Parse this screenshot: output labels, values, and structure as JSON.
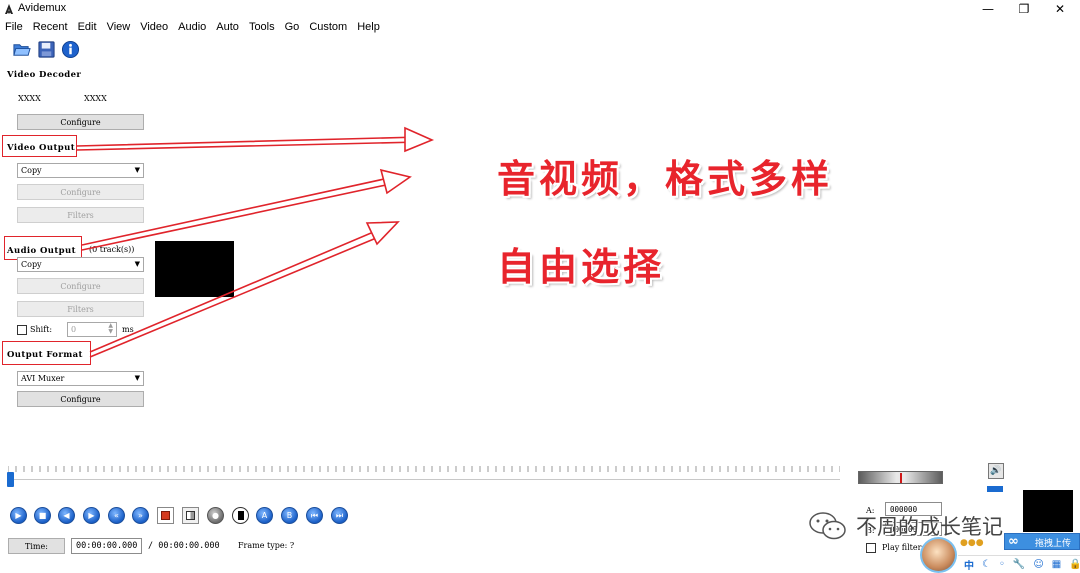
{
  "window": {
    "title": "Avidemux",
    "minimize": "—",
    "maximize": "❐",
    "close": "✕"
  },
  "menu": [
    "File",
    "Recent",
    "Edit",
    "View",
    "Video",
    "Audio",
    "Auto",
    "Tools",
    "Go",
    "Custom",
    "Help"
  ],
  "toolbar": {
    "icons": [
      "open-folder-icon",
      "save-icon",
      "info-icon"
    ]
  },
  "video_decoder": {
    "title": "Video Decoder",
    "codec_left": "XXXX",
    "codec_right": "XXXX",
    "configure": "Configure"
  },
  "video_output": {
    "title": "Video Output",
    "codec": "Copy",
    "configure": "Configure",
    "filters": "Filters"
  },
  "audio_output": {
    "title": "Audio Output",
    "tracks": "(0 track(s))",
    "codec": "Copy",
    "configure": "Configure",
    "filters": "Filters",
    "shift_label": "Shift:",
    "shift_value": "0",
    "shift_unit": "ms"
  },
  "output_format": {
    "title": "Output Format",
    "muxer": "AVI Muxer",
    "configure": "Configure"
  },
  "overlay": {
    "line1": "音视频，格式多样",
    "line2": "自由选择"
  },
  "timeline": {
    "position_fraction": 0.0
  },
  "status": {
    "time_label": "Time:",
    "current_time": "00:00:00.000",
    "total_time": "/ 00:00:00.000",
    "frame_type": "Frame type:  ?",
    "marker_a_label": "A:",
    "marker_a_value": "000000",
    "marker_b_label": "B:",
    "marker_b_value": "000000",
    "play_filtered": "Play filtered"
  },
  "watermark": {
    "text": "不周的成长笔记",
    "upload_label": "拖拽上传",
    "tray": "中"
  },
  "colors": {
    "annotation_red": "#e0242b",
    "overlay_red": "#e8242c",
    "slider_blue": "#1a6bd0"
  }
}
